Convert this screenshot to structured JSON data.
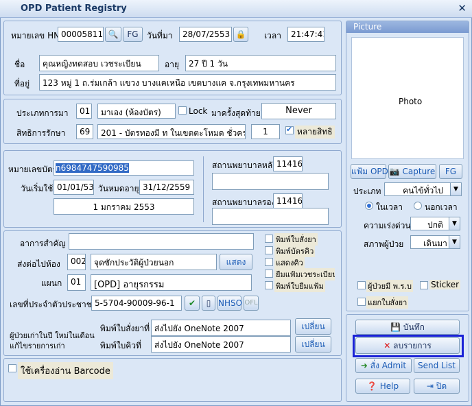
{
  "window": {
    "title": "OPD Patient Registry",
    "close": "✕"
  },
  "header": {
    "hn_label": "หมายเลข HN",
    "hn_value": "000058116",
    "fg_label": "FG",
    "visit_date_label": "วันที่มา",
    "visit_date_value": "28/07/2553",
    "time_label": "เวลา",
    "time_value": "21:47:41",
    "name_label": "ชื่อ",
    "name_value": "คุณหญิงทดสอบ เวชระเบียน",
    "age_label": "อายุ",
    "age_value": "27 ปี 1 วัน",
    "address_label": "ที่อยู่",
    "address_value": "123 หมู่ 1 ถ.ร่มเกล้า แขวง บางแคเหนือ เขตบางแค จ.กรุงเทพมหานคร"
  },
  "visit": {
    "type_label": "ประเภทการมา",
    "type_code": "01",
    "type_value": "มาเอง (ห้องบัตร)",
    "lock_label": "Lock",
    "last_visit_label": "มาครั้งสุดท้าย",
    "last_visit_value": "Never",
    "right_label": "สิทธิการรักษา",
    "right_code": "69",
    "right_value": "201 - บัตรทองมี ท ในเขตตะโหมด ชั่วคราว",
    "right_count": "1",
    "multi_right_label": "หลายสิทธิ"
  },
  "card": {
    "card_no_label": "หมายเลขบัตร",
    "card_no_value": "n6984747590985",
    "start_label": "วันเริ่มใช้",
    "start_value": "01/01/53",
    "expire_label": "วันหมดอายุ",
    "expire_value": "31/12/2559",
    "date_display": "1 มกราคม 2553",
    "main_hosp_label": "สถานพยาบาลหลัก",
    "main_hosp_code": "11416",
    "sub_hosp_label": "สถานพยาบาลรอง",
    "sub_hosp_code": "11416"
  },
  "referral": {
    "symptom_label": "อาการสำคัญ",
    "room_label": "ส่งต่อไปห้อง",
    "room_code": "002",
    "room_value": "จุดซักประวัติผู้ป่วยนอก",
    "show_label": "แสดง",
    "dept_label": "แผนก",
    "dept_code": "01",
    "dept_value": "[OPD] อายุรกรรม",
    "cid_label": "เลขที่ประจำตัวประชาชน",
    "cid_value": "5-5704-90009-96-1",
    "nhso_label": "NHSO",
    "ofl_label": "OFL",
    "print_options": [
      "พิมพ์ใบสั่งยา",
      "พิมพ์บัตรคิว",
      "แสดงคิว",
      "ยืมแฟ้มเวชระเบียน",
      "พิมพ์ใบยืมแฟ้ม"
    ],
    "old_new_label": "ผู้ป่วยเก่าในปี ใหม่ในเดือน แก้ไขรายการเก่า",
    "print_drug_label": "พิมพ์ใบสั่งยาที่",
    "print_drug_value": "ส่งไปยัง OneNote 2007",
    "print_queue_label": "พิมพ์ใบคิวที่",
    "print_queue_value": "ส่งไปยัง OneNote 2007",
    "change_label": "เปลี่ยน",
    "barcode_label": "ใช้เครื่องอ่าน Barcode"
  },
  "side": {
    "picture_title": "Picture",
    "photo_label": "Photo",
    "opd_folder_label": "แฟ้ม OPD",
    "capture_label": "Capture",
    "fg_label": "FG",
    "type_label": "ประเภท",
    "type_value": "คนไข้ทั่วไป",
    "in_hours_label": "ในเวลา",
    "out_hours_label": "นอกเวลา",
    "urgency_label": "ความเร่งด่วน",
    "urgency_value": "ปกติ",
    "condition_label": "สภาพผู้ป่วย",
    "condition_value": "เดินมา",
    "card_patient_label": "ผู้ป่วยมี พ.ร.บ",
    "sticker_label": "Sticker",
    "split_label": "แยกใบสั่งยา"
  },
  "actions": {
    "save": "บันทึก",
    "delete": "ลบรายการ",
    "admit": "สั่ง Admit",
    "send_list": "Send List",
    "help": "Help",
    "close": "ปิด"
  }
}
